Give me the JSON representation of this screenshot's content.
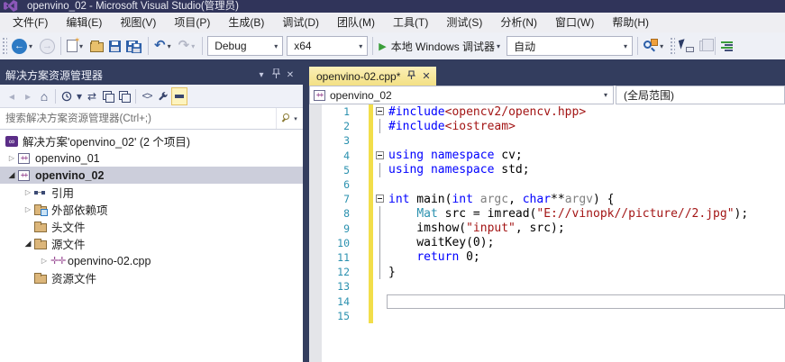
{
  "window": {
    "title": "openvino_02 - Microsoft Visual Studio(管理员)"
  },
  "menu": {
    "items": [
      "文件(F)",
      "编辑(E)",
      "视图(V)",
      "项目(P)",
      "生成(B)",
      "调试(D)",
      "团队(M)",
      "工具(T)",
      "测试(S)",
      "分析(N)",
      "窗口(W)",
      "帮助(H)"
    ]
  },
  "toolbar": {
    "config": "Debug",
    "platform": "x64",
    "debugger_label": "本地 Windows 调试器",
    "attach_label": "自动"
  },
  "solution_explorer": {
    "title": "解决方案资源管理器",
    "search_placeholder": "搜索解决方案资源管理器(Ctrl+;)",
    "tree": [
      {
        "label": "解决方案'openvino_02' (2 个项目)",
        "icon": "solution",
        "level": 0,
        "expander": "none",
        "selected": false,
        "bold": false
      },
      {
        "label": "openvino_01",
        "icon": "project",
        "level": 1,
        "expander": "collapsed",
        "selected": false,
        "bold": false
      },
      {
        "label": "openvino_02",
        "icon": "project",
        "level": 1,
        "expander": "expanded",
        "selected": true,
        "bold": true
      },
      {
        "label": "引用",
        "icon": "references",
        "level": 2,
        "expander": "collapsed",
        "selected": false,
        "bold": false
      },
      {
        "label": "外部依赖项",
        "icon": "ext-deps",
        "level": 2,
        "expander": "collapsed",
        "selected": false,
        "bold": false
      },
      {
        "label": "头文件",
        "icon": "folder",
        "level": 2,
        "expander": "none",
        "selected": false,
        "bold": false
      },
      {
        "label": "源文件",
        "icon": "folder",
        "level": 2,
        "expander": "expanded",
        "selected": false,
        "bold": false
      },
      {
        "label": "openvino-02.cpp",
        "icon": "cpp-file",
        "level": 3,
        "expander": "collapsed",
        "selected": false,
        "bold": false
      },
      {
        "label": "资源文件",
        "icon": "folder",
        "level": 2,
        "expander": "none",
        "selected": false,
        "bold": false
      }
    ]
  },
  "editor": {
    "tab_label": "openvino-02.cpp*",
    "navbar": {
      "project": "openvino_02",
      "scope": "(全局范围)"
    },
    "code": {
      "current_line": 14,
      "lines": [
        {
          "n": 1,
          "fold": "box",
          "changed": true,
          "tokens": [
            [
              "#include",
              "kw"
            ],
            [
              "<opencv2/opencv.hpp>",
              "str"
            ]
          ]
        },
        {
          "n": 2,
          "fold": "guide",
          "changed": true,
          "tokens": [
            [
              "#include",
              "kw"
            ],
            [
              "<iostream>",
              "str"
            ]
          ]
        },
        {
          "n": 3,
          "fold": "",
          "changed": true,
          "tokens": []
        },
        {
          "n": 4,
          "fold": "box",
          "changed": true,
          "tokens": [
            [
              "using",
              "kw"
            ],
            [
              " ",
              "pl"
            ],
            [
              "namespace",
              "kw"
            ],
            [
              " cv;",
              "pl"
            ]
          ]
        },
        {
          "n": 5,
          "fold": "guide",
          "changed": true,
          "tokens": [
            [
              "using",
              "kw"
            ],
            [
              " ",
              "pl"
            ],
            [
              "namespace",
              "kw"
            ],
            [
              " std;",
              "pl"
            ]
          ]
        },
        {
          "n": 6,
          "fold": "",
          "changed": true,
          "tokens": []
        },
        {
          "n": 7,
          "fold": "box",
          "changed": true,
          "tokens": [
            [
              "int",
              "kw"
            ],
            [
              " main(",
              "pl"
            ],
            [
              "int",
              "kw"
            ],
            [
              " ",
              "pl"
            ],
            [
              "argc",
              "param"
            ],
            [
              ", ",
              "pl"
            ],
            [
              "char",
              "kw"
            ],
            [
              "**",
              "pl"
            ],
            [
              "argv",
              "param"
            ],
            [
              ") {",
              "pl"
            ]
          ]
        },
        {
          "n": 8,
          "fold": "guide",
          "changed": true,
          "tokens": [
            [
              "    ",
              "pl"
            ],
            [
              "Mat",
              "type"
            ],
            [
              " src = imread(",
              "pl"
            ],
            [
              "\"E://vinopk//picture//2.jpg\"",
              "str"
            ],
            [
              ");",
              "pl"
            ]
          ]
        },
        {
          "n": 9,
          "fold": "guide",
          "changed": true,
          "tokens": [
            [
              "    imshow(",
              "pl"
            ],
            [
              "\"input\"",
              "str"
            ],
            [
              ", src);",
              "pl"
            ]
          ]
        },
        {
          "n": 10,
          "fold": "guide",
          "changed": true,
          "tokens": [
            [
              "    waitKey(0);",
              "pl"
            ]
          ]
        },
        {
          "n": 11,
          "fold": "guide",
          "changed": true,
          "tokens": [
            [
              "    ",
              "pl"
            ],
            [
              "return",
              "kw"
            ],
            [
              " 0;",
              "pl"
            ]
          ]
        },
        {
          "n": 12,
          "fold": "guide",
          "changed": true,
          "tokens": [
            [
              "}",
              "pl"
            ]
          ]
        },
        {
          "n": 13,
          "fold": "",
          "changed": true,
          "tokens": []
        },
        {
          "n": 14,
          "fold": "",
          "changed": true,
          "tokens": []
        },
        {
          "n": 15,
          "fold": "",
          "changed": true,
          "tokens": []
        }
      ]
    }
  },
  "colors": {
    "titlebar_bg": "#30345A",
    "main_bg": "#333D5E",
    "menubar_bg": "#EEEEF2",
    "active_tab_bg": "#F6E792",
    "change_bar": "#F2DE4A",
    "inactive_selection": "#CCCEDB",
    "line_number": "#2B91AF",
    "keyword": "#0000FF",
    "string": "#A31515",
    "type": "#2B91AF",
    "run_green": "#3A9E3A"
  }
}
